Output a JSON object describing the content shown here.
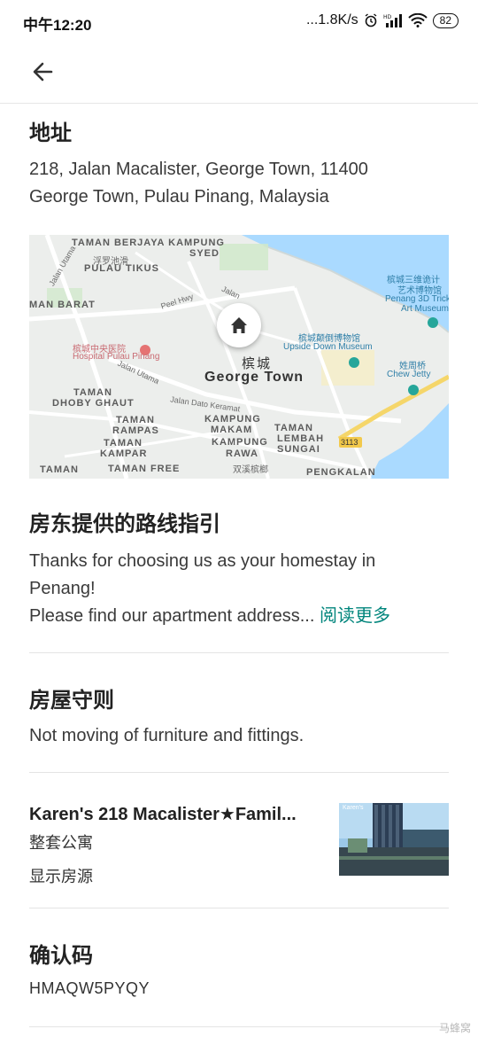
{
  "status_bar": {
    "time": "中午12:20",
    "network_speed": "...1.8K/s",
    "battery": "82"
  },
  "address": {
    "heading": "地址",
    "line1": "218, Jalan Macalister, George Town, 11400",
    "line2": "George Town, Pulau Pinang, Malaysia"
  },
  "map": {
    "labels": {
      "taman_berjaya": "TAMAN BERJAYA KAMPUNG",
      "syed": "SYED",
      "fuluo": "浮罗池滑",
      "pulau_tikus": "PULAU TIKUS",
      "man_barat": "MAN BARAT",
      "peel_hwy": "Peel Hwy",
      "jalan_utama": "Jalan Utama",
      "hospital_cn": "槟城中央医院",
      "hospital_en": "Hospital Pulau Pinang",
      "museum_3d_cn": "槟城三维诡计",
      "museum_3d_cn2": "艺术博物馆",
      "museum_3d_en": "Penang 3D Trick",
      "museum_3d_en2": "Art Museum",
      "upside_down_cn": "槟城颠倒博物馆",
      "upside_down_en": "Upside Down Museum",
      "chew_jetty_cn": "姓周桥",
      "chew_jetty_en": "Chew Jetty",
      "city_cn": "槟城",
      "city_en": "George Town",
      "taman_dhoby": "TAMAN",
      "dhoby_ghaut": "DHOBY GHAUT",
      "jalan_dato": "Jalan Dato Keramat",
      "taman_rampas": "TAMAN",
      "rampas": "RAMPAS",
      "taman_kampar": "TAMAN",
      "kampar": "KAMPAR",
      "kampung_makam": "KAMPUNG",
      "makam": "MAKAM",
      "kampung_rawa": "KAMPUNG",
      "rawa": "RAWA",
      "taman_lembah": "TAMAN",
      "lembah_sungai": "LEMBAH",
      "sungai": "SUNGAI",
      "route_3113": "3113",
      "taman_left": "TAMAN",
      "taman_free": "TAMAN FREE",
      "shuangxi": "双溪槟榔",
      "pengkalan": "PENGKALAN",
      "jalan_right": "Jalan"
    }
  },
  "directions": {
    "heading": "房东提供的路线指引",
    "line1": "Thanks for choosing us as your homestay in",
    "line2": "Penang!",
    "line3": "Please find our apartment address...",
    "read_more": "阅读更多"
  },
  "house_rules": {
    "heading": "房屋守则",
    "text": "Not moving of furniture and fittings."
  },
  "listing": {
    "title": "Karen's 218 Macalister★Famil...",
    "type": "整套公寓",
    "show_listing": "显示房源",
    "thumb_caption": "Karen's"
  },
  "confirmation": {
    "heading": "确认码",
    "code": "HMAQW5PYQY"
  },
  "watermark": "马蜂窝",
  "colors": {
    "accent": "#00857c",
    "text": "#222222",
    "divider": "#e4e4e4"
  }
}
